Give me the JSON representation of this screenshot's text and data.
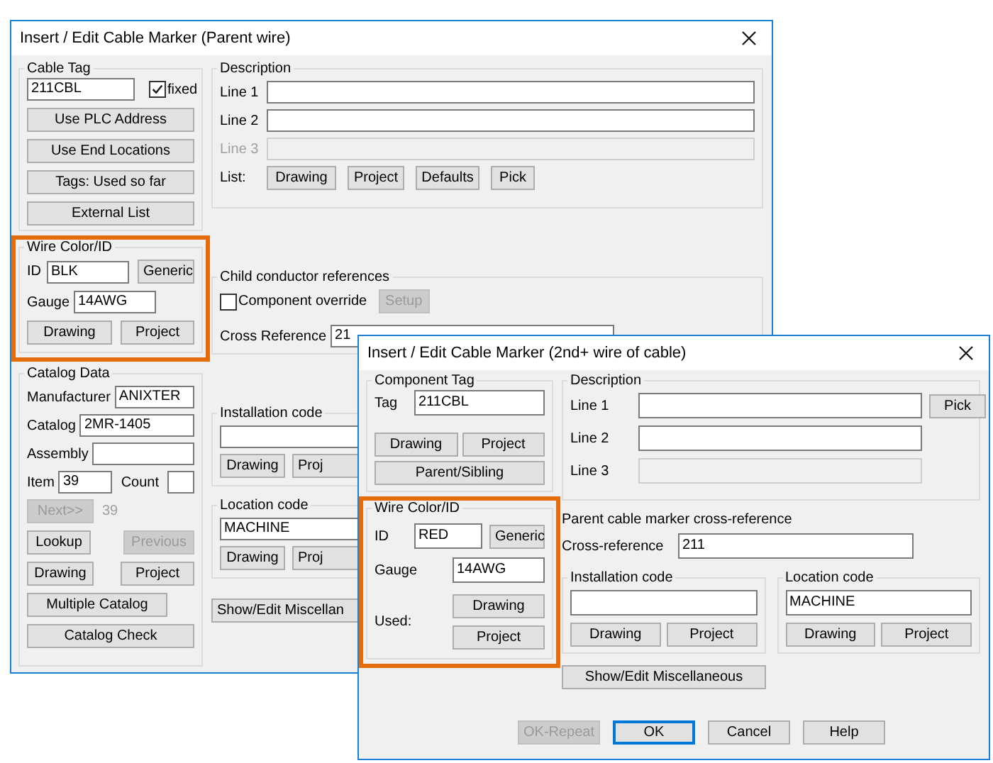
{
  "parent_dialog": {
    "title": "Insert / Edit Cable Marker (Parent wire)",
    "cable_tag": {
      "title": "Cable Tag",
      "value": "211CBL",
      "fixed": {
        "label": "fixed",
        "checked": true
      },
      "buttons": [
        "Use PLC Address",
        "Use End Locations",
        "Tags: Used so far",
        "External List"
      ]
    },
    "wire_color": {
      "title": "Wire Color/ID",
      "highlighted": true,
      "id_label": "ID",
      "id_value": "BLK",
      "generic_button": "Generic",
      "gauge_label": "Gauge",
      "gauge_value": "14AWG",
      "buttons": [
        "Drawing",
        "Project"
      ]
    },
    "catalog_data": {
      "title": "Catalog Data",
      "manufacturer": {
        "label": "Manufacturer",
        "value": "ANIXTER"
      },
      "catalog": {
        "label": "Catalog",
        "value": "2MR-1405"
      },
      "assembly": {
        "label": "Assembly"
      },
      "item": {
        "label": "Item",
        "value": "39"
      },
      "count": {
        "label": "Count"
      },
      "next": {
        "label": "Next>>",
        "disabled": true
      },
      "next_number": "39",
      "lookup": {
        "label": "Lookup",
        "disabled": false
      },
      "previous": {
        "label": "Previous",
        "disabled": true
      },
      "drawing_button": "Drawing",
      "project_button": "Project",
      "multiple_catalog_button": "Multiple Catalog",
      "catalog_check_button": "Catalog Check"
    },
    "description": {
      "title": "Description",
      "lines": [
        {
          "label": "Line 1",
          "disabled": false
        },
        {
          "label": "Line 2",
          "disabled": false
        },
        {
          "label": "Line 3",
          "disabled": true
        }
      ],
      "list_label": "List:",
      "list_buttons": [
        "Drawing",
        "Project",
        "Defaults",
        "Pick"
      ]
    },
    "child_references": {
      "title": "Child conductor references",
      "component_override": {
        "label": "Component override",
        "checked": false
      },
      "setup": {
        "label": "Setup",
        "disabled": true
      },
      "cross_reference_label": "Cross Reference",
      "cross_reference_value": "21"
    },
    "installation_code": {
      "title": "Installation code",
      "buttons": [
        "Drawing",
        "Proj"
      ]
    },
    "location_code": {
      "title": "Location code",
      "value": "MACHINE",
      "buttons": [
        "Drawing",
        "Proj"
      ]
    },
    "misc_button": "Show/Edit Miscellan"
  },
  "child_dialog": {
    "title": "Insert / Edit Cable Marker (2nd+ wire of cable)",
    "component_tag": {
      "title": "Component Tag",
      "tag_label": "Tag",
      "tag_value": "211CBL",
      "buttons": [
        "Drawing",
        "Project"
      ],
      "parent_sibling_button": "Parent/Sibling"
    },
    "wire_color": {
      "title": "Wire Color/ID",
      "highlighted": true,
      "id_label": "ID",
      "id_value": "RED",
      "generic_button": "Generic",
      "gauge_label": "Gauge",
      "gauge_value": "14AWG",
      "used_label": "Used:",
      "used_buttons": [
        "Drawing",
        "Project"
      ]
    },
    "description": {
      "title": "Description",
      "lines": [
        {
          "label": "Line 1",
          "disabled": false
        },
        {
          "label": "Line 2",
          "disabled": false
        },
        {
          "label": "Line 3",
          "disabled": true
        }
      ],
      "pick_button": "Pick"
    },
    "parent_reference": {
      "title": "Parent cable marker cross-reference",
      "label": "Cross-reference",
      "value": "211"
    },
    "installation_code": {
      "title": "Installation code",
      "buttons": [
        "Drawing",
        "Project"
      ]
    },
    "location_code": {
      "title": "Location code",
      "value": "MACHINE",
      "buttons": [
        "Drawing",
        "Project"
      ]
    },
    "misc_button": "Show/Edit Miscellaneous",
    "footer_buttons": [
      {
        "label": "OK-Repeat",
        "disabled": true,
        "default": false
      },
      {
        "label": "OK",
        "disabled": false,
        "default": true
      },
      {
        "label": "Cancel",
        "disabled": false,
        "default": false
      },
      {
        "label": "Help",
        "disabled": false,
        "default": false
      }
    ]
  }
}
